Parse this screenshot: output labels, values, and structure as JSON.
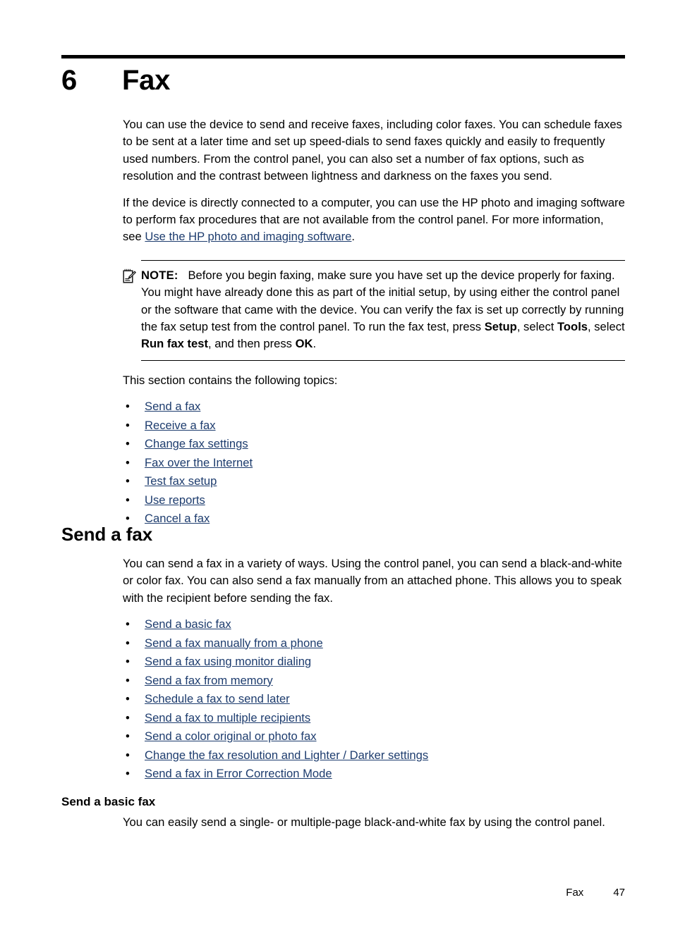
{
  "chapter": {
    "number": "6",
    "title": "Fax"
  },
  "intro": {
    "paragraph1": "You can use the device to send and receive faxes, including color faxes. You can schedule faxes to be sent at a later time and set up speed-dials to send faxes quickly and easily to frequently used numbers. From the control panel, you can also set a number of fax options, such as resolution and the contrast between lightness and darkness on the faxes you send.",
    "paragraph2_before_link": "If the device is directly connected to a computer, you can use the HP photo and imaging software to perform fax procedures that are not available from the control panel. For more information, see ",
    "paragraph2_link": "Use the HP photo and imaging software",
    "paragraph2_after_link": "."
  },
  "note": {
    "icon": "note-pad-pencil-icon",
    "label": "NOTE:",
    "text_part1": "Before you begin faxing, make sure you have set up the device properly for faxing. You might have already done this as part of the initial setup, by using either the control panel or the software that came with the device. You can verify the fax is set up correctly by running the fax setup test from the control panel. To run the fax test, press ",
    "bold1": "Setup",
    "text_part2": ", select ",
    "bold2": "Tools",
    "text_part3": ", select ",
    "bold3": "Run fax test",
    "text_part4": ", and then press ",
    "bold4": "OK",
    "text_part5": "."
  },
  "topics_intro": "This section contains the following topics:",
  "topics": [
    {
      "label": "Send a fax"
    },
    {
      "label": "Receive a fax"
    },
    {
      "label": "Change fax settings"
    },
    {
      "label": "Fax over the Internet"
    },
    {
      "label": "Test fax setup"
    },
    {
      "label": "Use reports"
    },
    {
      "label": "Cancel a fax"
    }
  ],
  "send_a_fax": {
    "heading": "Send a fax",
    "paragraph": "You can send a fax in a variety of ways. Using the control panel, you can send a black-and-white or color fax. You can also send a fax manually from an attached phone. This allows you to speak with the recipient before sending the fax.",
    "links": [
      {
        "label": "Send a basic fax"
      },
      {
        "label": "Send a fax manually from a phone"
      },
      {
        "label": "Send a fax using monitor dialing"
      },
      {
        "label": "Send a fax from memory"
      },
      {
        "label": "Schedule a fax to send later"
      },
      {
        "label": "Send a fax to multiple recipients"
      },
      {
        "label": "Send a color original or photo fax"
      },
      {
        "label": "Change the fax resolution and Lighter / Darker settings"
      },
      {
        "label": "Send a fax in Error Correction Mode"
      }
    ]
  },
  "send_a_basic_fax": {
    "heading": "Send a basic fax",
    "paragraph": "You can easily send a single- or multiple-page black-and-white fax by using the control panel."
  },
  "footer": {
    "section": "Fax",
    "page_number": "47"
  },
  "bullet_glyph": "•",
  "colors": {
    "link": "#1d3c6e",
    "text": "#000000",
    "rule": "#000000"
  }
}
